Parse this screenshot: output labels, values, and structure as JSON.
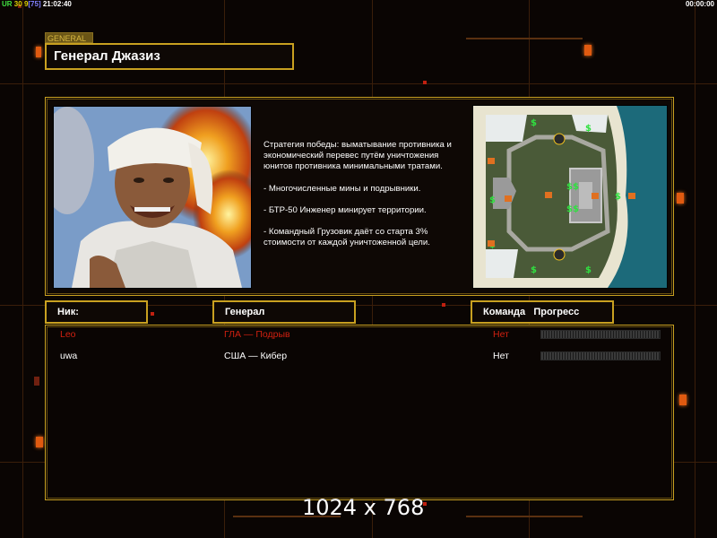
{
  "topbar": {
    "ur_label": "UR",
    "ur_num1": "30",
    "ur_num2": "9",
    "ur_num3": "[75]",
    "clock": "21:02:40",
    "timer": "00:00:00"
  },
  "general_tag": "GENERAL",
  "general_name": "Генерал Джазиз",
  "description": [
    "Стратегия победы: выматывание противника и экономический перевес путём уничтожения юнитов противника минимальными тратами.",
    "- Многочисленные мины и подрывники.",
    "- БТР-50 Инженер минирует территории.",
    "- Командный Грузовик даёт со старта 3% стоимости от каждой уничтоженной цели."
  ],
  "columns": {
    "nick": "Ник:",
    "general": "Генерал",
    "team": "Команда",
    "progress": "Прогресс"
  },
  "players": [
    {
      "nick": "Leo",
      "general": "ГЛА — Подрыв",
      "team": "Нет",
      "progress": 0,
      "color": "#d02010"
    },
    {
      "nick": "uwa",
      "general": "США — Кибер",
      "team": "Нет",
      "progress": 0,
      "color": "#ffffff"
    }
  ],
  "resolution": "1024 x 768",
  "colors": {
    "accent": "#c8a020",
    "ur_green": "#40e040",
    "ur_yellow": "#e0d000",
    "bracket": "#8080ff"
  },
  "minimap": {
    "icons": [
      "dollar-icon",
      "supply-truck-icon",
      "player-start-icon"
    ]
  }
}
